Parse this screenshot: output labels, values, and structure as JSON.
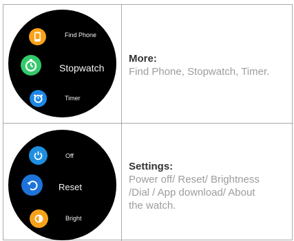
{
  "rows": [
    {
      "watch_items": [
        {
          "label": "Find Phone",
          "icon": "phone-icon",
          "color": "#f7a21b"
        },
        {
          "label": "Stopwatch",
          "icon": "stopwatch-icon",
          "color": "#34c96a"
        },
        {
          "label": "Timer",
          "icon": "timer-icon",
          "color": "#1e88e5"
        }
      ],
      "heading": "More:",
      "description": "Find Phone, Stopwatch, Timer."
    },
    {
      "watch_items": [
        {
          "label": "Off",
          "icon": "power-icon",
          "color": "#1e8fe0"
        },
        {
          "label": "Reset",
          "icon": "reset-icon",
          "color": "#1e73d9"
        },
        {
          "label": "Bright",
          "icon": "brightness-icon",
          "color": "#f7a21b"
        }
      ],
      "heading": "Settings:",
      "description_lines": [
        "Power off/ Reset/ Brightness",
        "/Dial / App download/ About",
        "the watch."
      ]
    }
  ]
}
